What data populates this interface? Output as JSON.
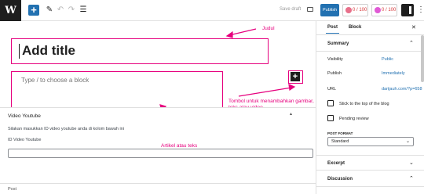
{
  "toolbar": {
    "logo": "W",
    "add_block_icon": "plus-icon",
    "save_draft": "Save draft",
    "publish": "Publish",
    "seo_score": "0 / 100",
    "readability_score": "0 / 100"
  },
  "editor": {
    "title_placeholder": "Add title",
    "block_placeholder": "Type / to choose a block"
  },
  "annotations": {
    "title": "Judul",
    "add_block": "Tombol untuk menambahkan gambar,",
    "add_block_line2": "teks atau video",
    "article": "Artikel atau teks"
  },
  "meta_box": {
    "title": "Video Youtube",
    "description": "Silakan masukkan ID video youtube anda di kolom bawah ini",
    "field_label": "ID Video Youtube",
    "field_value": "",
    "footer_label": "Post"
  },
  "sidebar": {
    "tabs": [
      "Post",
      "Block"
    ],
    "summary": {
      "label": "Summary",
      "rows": [
        {
          "label": "Visibility",
          "value": "Public"
        },
        {
          "label": "Publish",
          "value": "Immediately"
        },
        {
          "label": "URL",
          "value": "darijauh.com/?p=658"
        }
      ],
      "checks": [
        "Stick to the top of the blog",
        "Pending review"
      ],
      "post_format_label": "POST FORMAT",
      "post_format_value": "Standard"
    },
    "panels": [
      "Excerpt",
      "Discussion"
    ]
  },
  "colors": {
    "accent": "#2271b1",
    "annotation": "#e6007e",
    "score_red": "#d63638"
  }
}
